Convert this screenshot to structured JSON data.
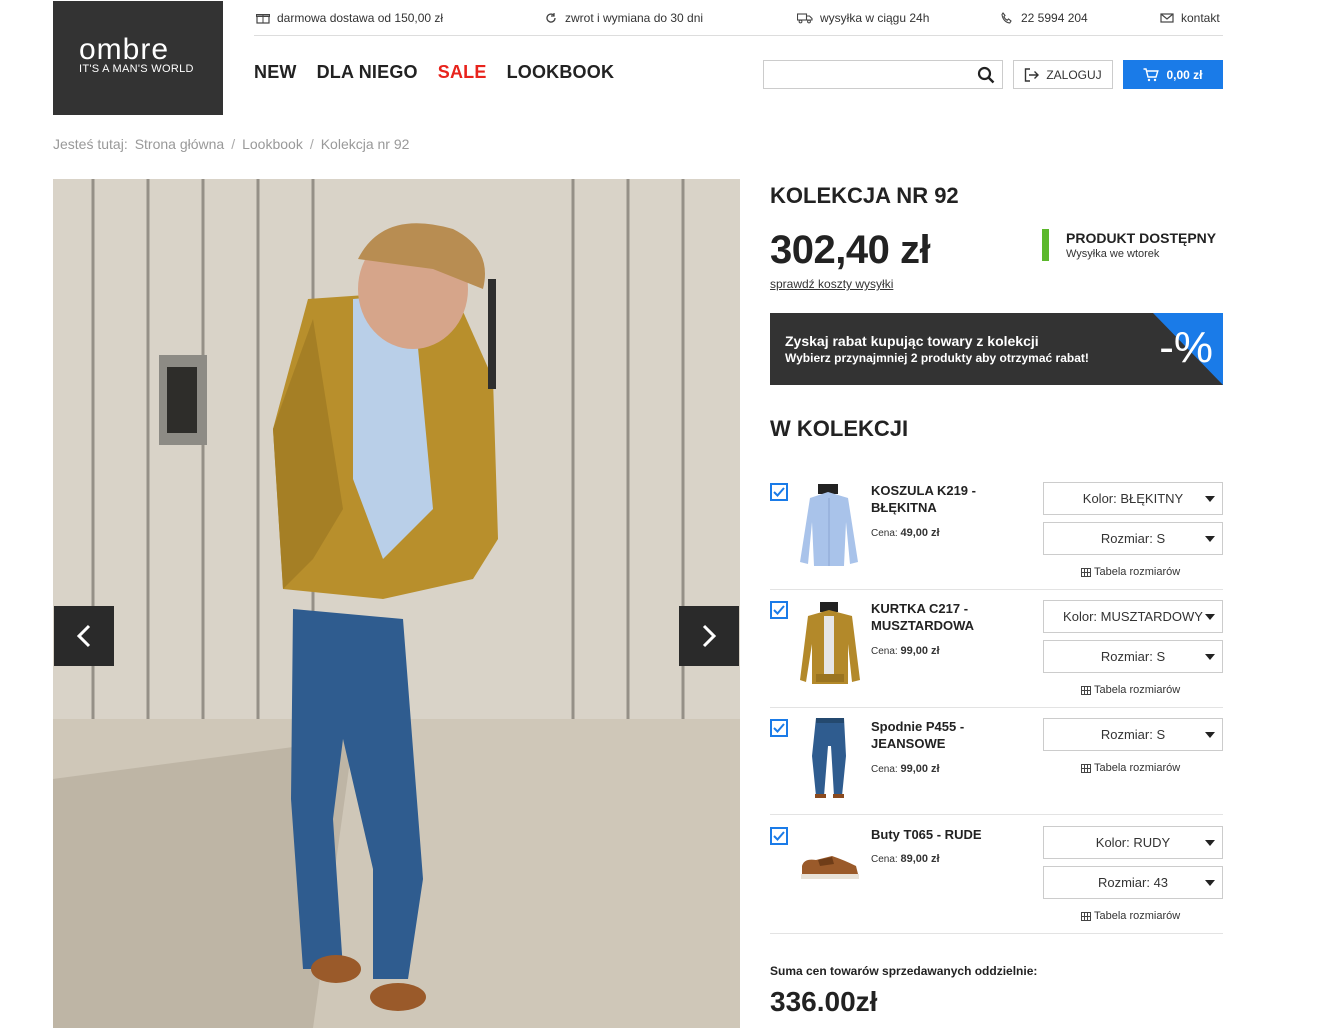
{
  "logo": {
    "wordmark": "ombre",
    "tagline": "IT'S A MAN'S WORLD"
  },
  "topbar": [
    {
      "icon": "gift-icon",
      "text": "darmowa dostawa od 150,00 zł"
    },
    {
      "icon": "refresh-icon",
      "text": "zwrot i wymiana do 30 dni"
    },
    {
      "icon": "truck-icon",
      "text": "wysyłka w ciągu 24h"
    },
    {
      "icon": "phone-icon",
      "text": "22 5994 204"
    },
    {
      "icon": "envelope-icon",
      "text": "kontakt"
    }
  ],
  "nav": {
    "new": "NEW",
    "dla_niego": "DLA NIEGO",
    "sale": "SALE",
    "lookbook": "LOOKBOOK"
  },
  "search": {
    "placeholder": ""
  },
  "login": {
    "label": "ZALOGUJ"
  },
  "cart": {
    "label": "0,00 zł"
  },
  "breadcrumb": {
    "prefix": "Jesteś tutaj:",
    "items": [
      "Strona główna",
      "Lookbook",
      "Kolekcja nr 92"
    ]
  },
  "product": {
    "title": "KOLEKCJA NR 92",
    "price": "302,40 zł",
    "shipping_link": "sprawdź koszty wysyłki",
    "availability": "PRODUKT DOSTĘPNY",
    "availability_sub": "Wysyłka we wtorek"
  },
  "promo": {
    "line1": "Zyskaj rabat kupując towary z kolekcji",
    "line2": "Wybierz przynajmniej 2 produkty aby otrzymać rabat!",
    "badge": "-%"
  },
  "collection": {
    "title": "W KOLEKCJI",
    "size_table_label": "Tabela rozmiarów",
    "price_label": "Cena:",
    "items": [
      {
        "name": "KOSZULA K219 - BŁĘKITNA",
        "price": "49,00 zł",
        "color": "Kolor: BŁĘKITNY",
        "size": "Rozmiar: S",
        "checked": true
      },
      {
        "name": "KURTKA C217 - MUSZTARDOWA",
        "price": "99,00 zł",
        "color": "Kolor: MUSZTARDOWY",
        "size": "Rozmiar: S",
        "checked": true
      },
      {
        "name": "Spodnie P455 - JEANSOWE",
        "price": "99,00 zł",
        "size": "Rozmiar: S",
        "checked": true
      },
      {
        "name": "Buty T065 - RUDE",
        "price": "89,00 zł",
        "color": "Kolor: RUDY",
        "size": "Rozmiar: 43",
        "checked": true
      }
    ]
  },
  "summary": {
    "label": "Suma cen towarów sprzedawanych oddzielnie:",
    "value": "336.00zł"
  },
  "colors": {
    "accent": "#1a7be8",
    "sale": "#e8231c",
    "available": "#5cb82c",
    "dark": "#333333"
  }
}
